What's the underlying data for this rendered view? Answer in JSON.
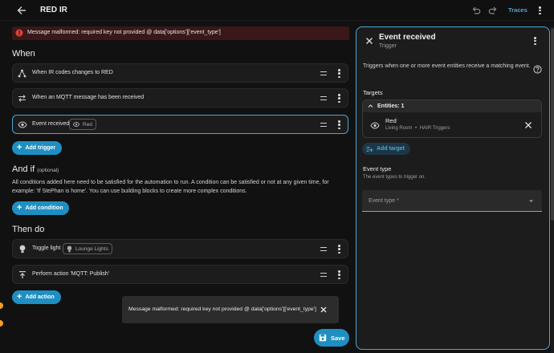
{
  "header": {
    "title": "RED IR",
    "traces_label": "Traces"
  },
  "error_banner": {
    "text": "Message malformed: required key not provided @ data['options']['event_type']"
  },
  "when": {
    "heading": "When",
    "triggers": [
      {
        "label": "When IR codes changes to RED",
        "icon": "graph-nodes-icon"
      },
      {
        "label": "When an MQTT message has been received",
        "icon": "swap-arrows-icon"
      },
      {
        "label": "Event received",
        "icon": "eye-event-icon",
        "chip": "Red"
      }
    ],
    "add_label": "Add trigger"
  },
  "and_if": {
    "heading": "And if",
    "optional": "(optional)",
    "description": "All conditions added here need to be satisfied for the automation to run. A condition can be satisfied or not at any given time, for example: 'If StePhan is home'. You can use building blocks to create more complex conditions.",
    "add_label": "Add condition"
  },
  "then_do": {
    "heading": "Then do",
    "actions": [
      {
        "label": "Toggle light",
        "icon": "bulb-icon",
        "chip": "Lounge Lights"
      },
      {
        "label": "Perform action 'MQTT: Publish'",
        "icon": "publish-icon"
      }
    ],
    "add_label": "Add action"
  },
  "toast": {
    "text": "Message malformed: required key not provided @ data['options']['event_type']"
  },
  "save_label": "Save",
  "panel": {
    "title": "Event received",
    "subtitle": "Trigger",
    "description": "Triggers when one or more event entities receive a matching event.",
    "targets_heading": "Targets",
    "entities_label": "Entities: 1",
    "entity": {
      "name": "Red",
      "area": "Living Room",
      "device": "HAIR Triggers",
      "separator": "•"
    },
    "add_target_label": "Add target",
    "event_type_heading": "Event type",
    "event_type_desc": "The event types to trigger on.",
    "event_type_placeholder": "Event type *"
  },
  "colors": {
    "accent": "#1f8fc2",
    "selection_border": "#4fa6d6",
    "error": "#db4437",
    "error_bg": "#3a1718"
  }
}
